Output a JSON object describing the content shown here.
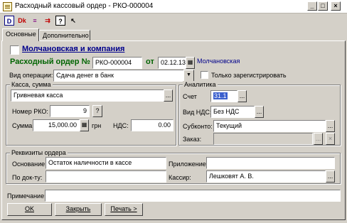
{
  "window": {
    "title": "Расходный кассовый ордер - РКО-000004",
    "minimize": "_",
    "maximize": "□",
    "close": "×"
  },
  "toolbar": {
    "icon_names": [
      "view-doc-icon",
      "print-icon",
      "structure-icon",
      "move-icon",
      "help-icon",
      "pointer-help-icon"
    ]
  },
  "tabs": [
    {
      "label": "Основные"
    },
    {
      "label": "Дополнительно"
    }
  ],
  "header": {
    "company": "Молчановская и компания",
    "doc_label": "Расходный ордер №",
    "doc_number": "РКО-000004",
    "date_label": "от",
    "date": "02.12.13",
    "company_short": "Молчановская"
  },
  "operation": {
    "label": "Вид операции:",
    "value": "Сдача денег в банк",
    "only_registered_label": "Только зарегистрировать"
  },
  "cash": {
    "group_title": "Касса, сумма",
    "cashbox": "Гривневая касса",
    "rko_label": "Номер РКО:",
    "rko_value": "9",
    "sum_label": "Сумма:",
    "sum_value": "15,000.00",
    "currency": "грн",
    "vat_label": "НДС:",
    "vat_value": "0.00"
  },
  "analytics": {
    "group_title": "Аналитика",
    "account_label": "Счет",
    "account_value": "31.1",
    "vat_type_label": "Вид НДС:",
    "vat_type_value": "Без НДС",
    "subconto_label": "Субконто:",
    "subconto_value": "Текущий",
    "order_label": "Заказ:",
    "order_value": ""
  },
  "requisites": {
    "group_title": "Реквизиты ордера",
    "basis_label": "Основание:",
    "basis_value": "Остаток наличности в кассе",
    "appendix_label": "Приложение:",
    "appendix_value": "",
    "by_doc_label": "По док-ту:",
    "by_doc_value": "",
    "cashier_label": "Кассир:",
    "cashier_value": "Лешковят А. В."
  },
  "note": {
    "label": "Примечание:",
    "value": ""
  },
  "buttons": {
    "ok": "OK",
    "close": "Закрыть",
    "print": "Печать >",
    "dots": "...",
    "question": "?",
    "x": "×",
    "dropdown": "▼"
  }
}
